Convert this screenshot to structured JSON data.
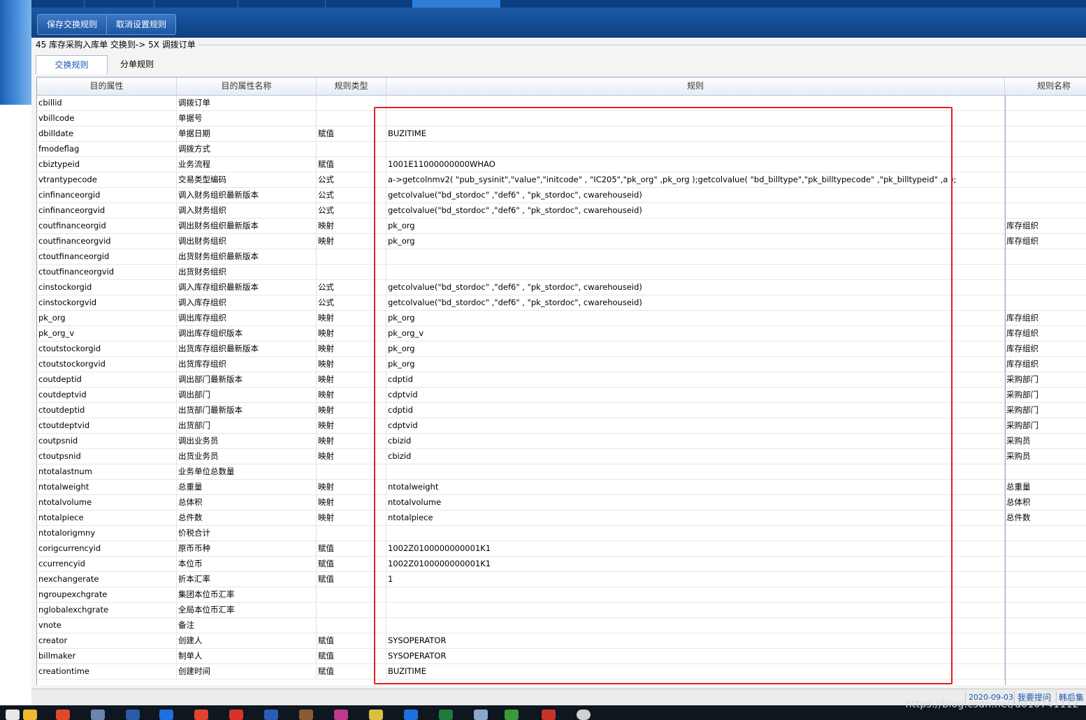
{
  "toolbar": {
    "save_label": "保存交换规则",
    "cancel_label": "取消设置规则"
  },
  "header": {
    "group_title": "45 库存采购入库单 交换到-> 5X 调拨订单"
  },
  "tabs": [
    {
      "label": "交换规则",
      "active": true
    },
    {
      "label": "分单规则",
      "active": false
    }
  ],
  "grid": {
    "columns": [
      "目的属性",
      "目的属性名称",
      "规则类型",
      "规则",
      "规则名称"
    ],
    "rows": [
      [
        "cbillid",
        "调拨订单",
        "",
        "",
        ""
      ],
      [
        "vbillcode",
        "单据号",
        "",
        "",
        ""
      ],
      [
        "dbilldate",
        "单据日期",
        "赋值",
        "BUZITIME",
        ""
      ],
      [
        "fmodeflag",
        "调拨方式",
        "",
        "",
        ""
      ],
      [
        "cbiztypeid",
        "业务流程",
        "赋值",
        "1001E11000000000WHAO",
        ""
      ],
      [
        "vtrantypecode",
        "交易类型编码",
        "公式",
        "a->getcolnmv2( \"pub_sysinit\",\"value\",\"initcode\" , \"IC205\",\"pk_org\" ,pk_org );getcolvalue( \"bd_billtype\",\"pk_billtypecode\" ,\"pk_billtypeid\" ,a );",
        ""
      ],
      [
        "cinfinanceorgid",
        "调入财务组织最新版本",
        "公式",
        "getcolvalue(\"bd_stordoc\" ,\"def6\" , \"pk_stordoc\", cwarehouseid)",
        ""
      ],
      [
        "cinfinanceorgvid",
        "调入财务组织",
        "公式",
        "getcolvalue(\"bd_stordoc\" ,\"def6\" , \"pk_stordoc\", cwarehouseid)",
        ""
      ],
      [
        "coutfinanceorgid",
        "调出财务组织最新版本",
        "映射",
        "pk_org",
        "库存组织"
      ],
      [
        "coutfinanceorgvid",
        "调出财务组织",
        "映射",
        "pk_org",
        "库存组织"
      ],
      [
        "ctoutfinanceorgid",
        "出货财务组织最新版本",
        "",
        "",
        ""
      ],
      [
        "ctoutfinanceorgvid",
        "出货财务组织",
        "",
        "",
        ""
      ],
      [
        "cinstockorgid",
        "调入库存组织最新版本",
        "公式",
        "getcolvalue(\"bd_stordoc\" ,\"def6\" , \"pk_stordoc\", cwarehouseid)",
        ""
      ],
      [
        "cinstockorgvid",
        "调入库存组织",
        "公式",
        "getcolvalue(\"bd_stordoc\" ,\"def6\" , \"pk_stordoc\", cwarehouseid)",
        ""
      ],
      [
        "pk_org",
        "调出库存组织",
        "映射",
        "pk_org",
        "库存组织"
      ],
      [
        "pk_org_v",
        "调出库存组织版本",
        "映射",
        "pk_org_v",
        "库存组织"
      ],
      [
        "ctoutstockorgid",
        "出货库存组织最新版本",
        "映射",
        "pk_org",
        "库存组织"
      ],
      [
        "ctoutstockorgvid",
        "出货库存组织",
        "映射",
        "pk_org",
        "库存组织"
      ],
      [
        "coutdeptid",
        "调出部门最新版本",
        "映射",
        "cdptid",
        "采购部门"
      ],
      [
        "coutdeptvid",
        "调出部门",
        "映射",
        "cdptvid",
        "采购部门"
      ],
      [
        "ctoutdeptid",
        "出货部门最新版本",
        "映射",
        "cdptid",
        "采购部门"
      ],
      [
        "ctoutdeptvid",
        "出货部门",
        "映射",
        "cdptvid",
        "采购部门"
      ],
      [
        "coutpsnid",
        "调出业务员",
        "映射",
        "cbizid",
        "采购员"
      ],
      [
        "ctoutpsnid",
        "出货业务员",
        "映射",
        "cbizid",
        "采购员"
      ],
      [
        "ntotalastnum",
        "业务单位总数量",
        "",
        "",
        ""
      ],
      [
        "ntotalweight",
        "总重量",
        "映射",
        "ntotalweight",
        "总重量"
      ],
      [
        "ntotalvolume",
        "总体积",
        "映射",
        "ntotalvolume",
        "总体积"
      ],
      [
        "ntotalpiece",
        "总件数",
        "映射",
        "ntotalpiece",
        "总件数"
      ],
      [
        "ntotalorigmny",
        "价税合计",
        "",
        "",
        ""
      ],
      [
        "corigcurrencyid",
        "原币币种",
        "赋值",
        "1002Z0100000000001K1",
        ""
      ],
      [
        "ccurrencyid",
        "本位币",
        "赋值",
        "1002Z0100000000001K1",
        ""
      ],
      [
        "nexchangerate",
        "折本汇率",
        "赋值",
        "1",
        ""
      ],
      [
        "ngroupexchgrate",
        "集团本位币汇率",
        "",
        "",
        ""
      ],
      [
        "nglobalexchgrate",
        "全局本位币汇率",
        "",
        "",
        ""
      ],
      [
        "vnote",
        "备注",
        "",
        "",
        ""
      ],
      [
        "creator",
        "创建人",
        "赋值",
        "SYSOPERATOR",
        ""
      ],
      [
        "billmaker",
        "制单人",
        "赋值",
        "SYSOPERATOR",
        ""
      ],
      [
        "creationtime",
        "创建时间",
        "赋值",
        "BUZITIME",
        ""
      ]
    ]
  },
  "status": {
    "date": "2020-09-03",
    "ask_label": "我要提问",
    "user": "韩后集"
  },
  "watermark": "https://blog.csdn.net/u010741112",
  "colors": {
    "toolbar_bg": "#1c5aa6",
    "accent": "#1a55b0",
    "highlight_border": "#e02020"
  }
}
